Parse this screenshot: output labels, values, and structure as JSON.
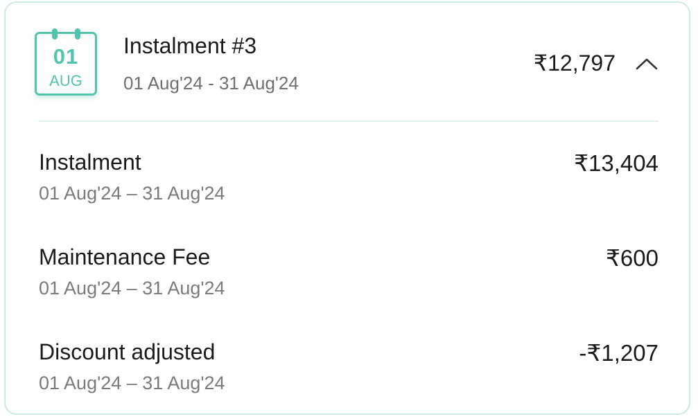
{
  "accent_color": "#52c4ae",
  "calendar": {
    "day": "01",
    "month": "AUG",
    "icon": "calendar-icon"
  },
  "header": {
    "title": "Instalment #3",
    "period": "01 Aug'24 - 31 Aug'24",
    "total": "₹12,797",
    "toggle_icon": "chevron-up-icon"
  },
  "items": [
    {
      "label": "Instalment",
      "period": "01 Aug'24 – 31 Aug'24",
      "amount": "₹13,404"
    },
    {
      "label": "Maintenance Fee",
      "period": "01 Aug'24 – 31 Aug'24",
      "amount": "₹600"
    },
    {
      "label": "Discount adjusted",
      "period": "01 Aug'24 – 31 Aug'24",
      "amount": "-₹1,207"
    }
  ]
}
